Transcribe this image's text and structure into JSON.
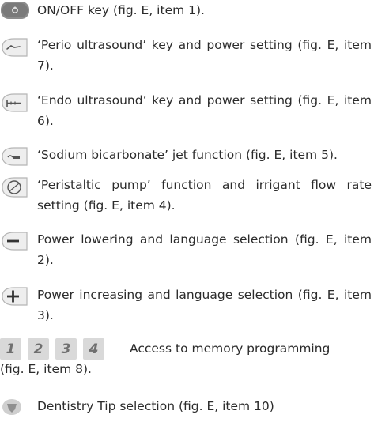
{
  "items": [
    {
      "icon": "on-off-key-icon",
      "text": "ON/OFF key (fig. E, item 1)."
    },
    {
      "icon": "perio-ultrasound-key-icon",
      "text": "‘Perio ultrasound’ key and power setting (fig. E, item 7)."
    },
    {
      "icon": "endo-ultrasound-key-icon",
      "text": "‘Endo ultrasound’ key and power setting (fig. E, item 6)."
    },
    {
      "icon": "sodium-bicarbonate-key-icon",
      "text": "‘Sodium bicarbonate’ jet function (fig. E, item 5)."
    },
    {
      "icon": "peristaltic-pump-key-icon",
      "text": "‘Peristaltic pump’ function and irrigant flow rate setting (fig. E, item 4)."
    },
    {
      "icon": "power-lowering-key-icon",
      "text": "Power lowering and language selection (fig. E, item 2)."
    },
    {
      "icon": "power-increasing-key-icon",
      "text": "Power increasing and language selection (fig. E, item 3)."
    }
  ],
  "memory": {
    "keys": [
      "1",
      "2",
      "3",
      "4"
    ],
    "text_line1": "Access to memory programming",
    "text_line2": "(fig. E, item 8)."
  },
  "last_item": {
    "icon": "dentistry-tip-key-icon",
    "text": "Dentistry Tip selection (fig. E, item 10)"
  }
}
